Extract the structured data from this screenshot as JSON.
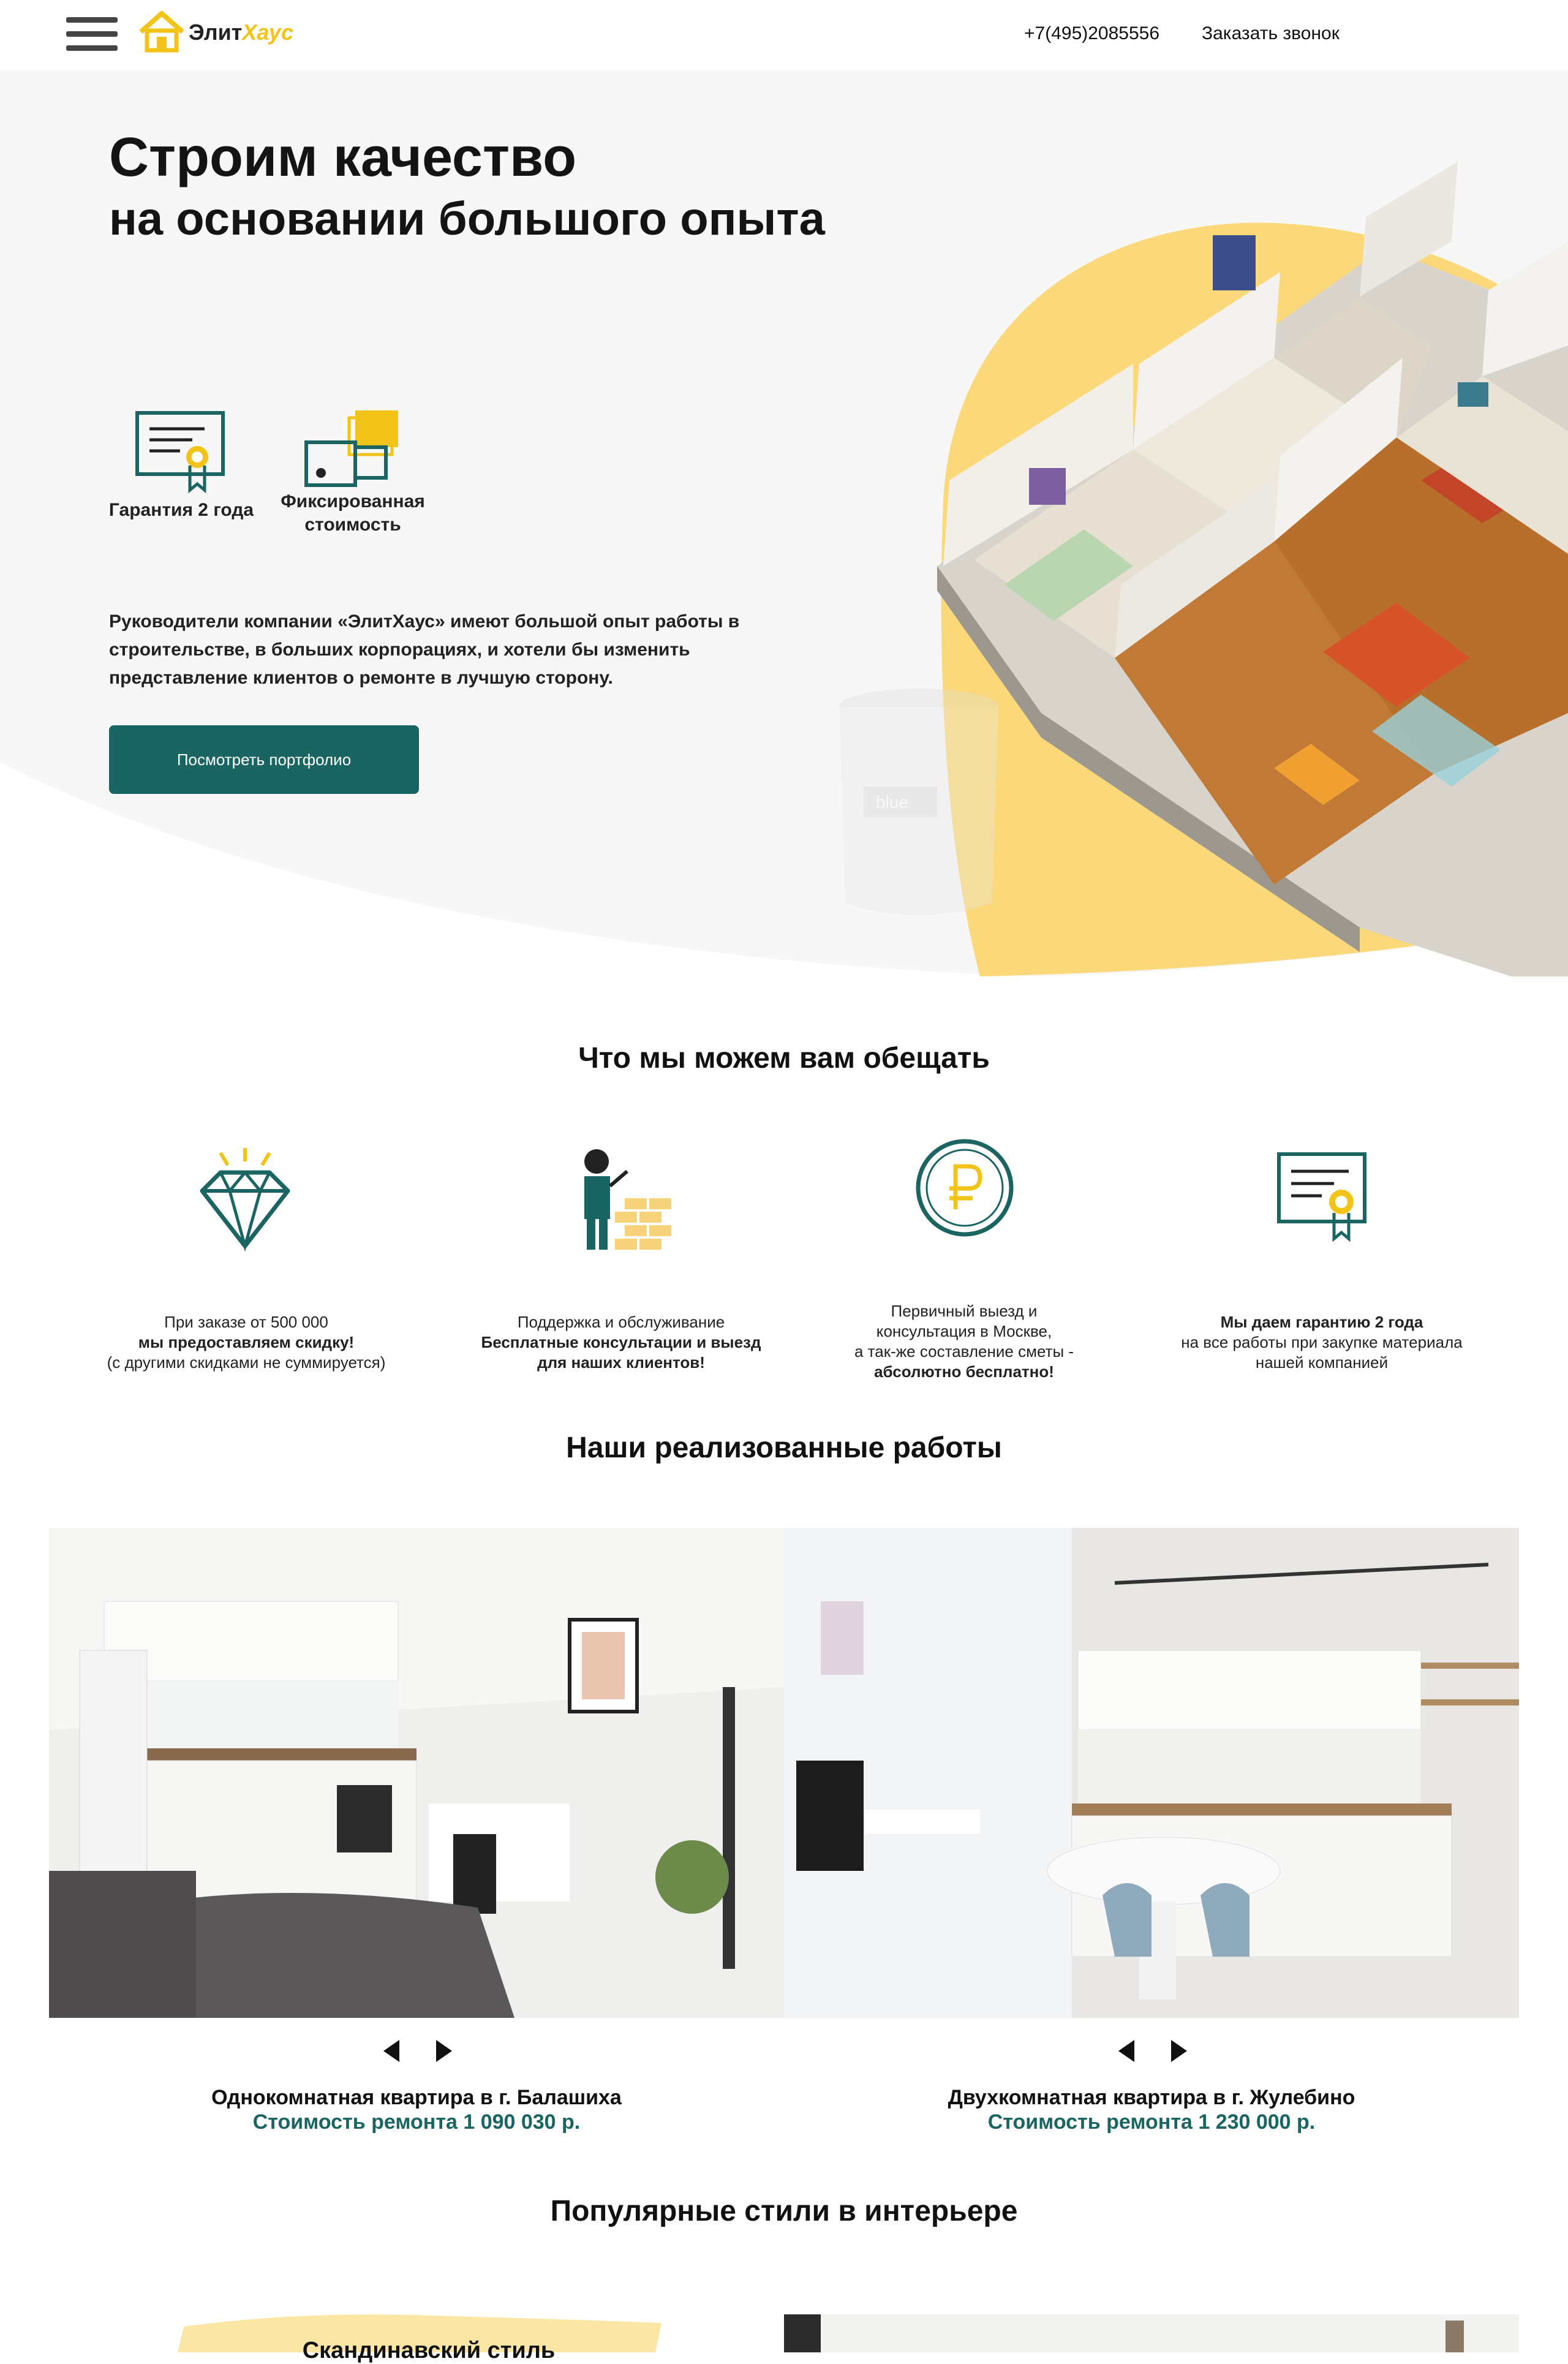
{
  "header": {
    "logo_part1": "Элит",
    "logo_part2": "Хаус",
    "phone": "+7(495)2085556",
    "callback": "Заказать звонок"
  },
  "hero": {
    "title_line1": "Строим качество",
    "title_line2": "на основании большого опыта",
    "features": [
      {
        "label": "Гарантия 2 года",
        "icon": "certificate-icon"
      },
      {
        "label": "Фиксированная стоимость",
        "icon": "hand-money-icon"
      }
    ],
    "description": "Руководители компании «ЭлитХаус» имеют большой опыт работы в строительстве, в больших корпорациях, и хотели бы изменить представление клиентов о ремонте в лучшую сторону.",
    "button": "Посмотреть портфолио",
    "bucket_label": "blue"
  },
  "promises": {
    "title": "Что мы можем вам обещать",
    "items": [
      {
        "icon": "diamond-icon",
        "line1": "При заказе от 500 000",
        "line2": "мы предоставляем скидку!",
        "line3": "(с другими скидками не суммируется)"
      },
      {
        "icon": "builder-icon",
        "line1": "Поддержка и обслуживание",
        "line2": "Бесплатные консультации и выезд",
        "line3": "для наших клиентов!"
      },
      {
        "icon": "ruble-coin-icon",
        "line1": "Первичный выезд и",
        "line2": "консультация в Москве,",
        "line3": "а так-же составление сметы -",
        "line4": "абсолютно бесплатно!"
      },
      {
        "icon": "certificate-icon",
        "line1": "Мы даем гарантию 2 года",
        "line2": "на все работы при закупке материала",
        "line3": "нашей компанией"
      }
    ]
  },
  "works": {
    "title": "Наши реализованные работы",
    "items": [
      {
        "name": "Однокомнатная квартира в г. Балашиха",
        "price": "Стоимость ремонта 1 090 030 р."
      },
      {
        "name": "Двухкомнатная квартира в г. Жулебино",
        "price": "Стоимость ремонта 1 230 000 р."
      }
    ]
  },
  "styles": {
    "title": "Популярные стили в интерьере",
    "first_card": "Скандинавский стиль"
  },
  "colors": {
    "accent": "#1a6461",
    "yellow": "#fbd97a",
    "brand_yellow": "#f2c318"
  }
}
